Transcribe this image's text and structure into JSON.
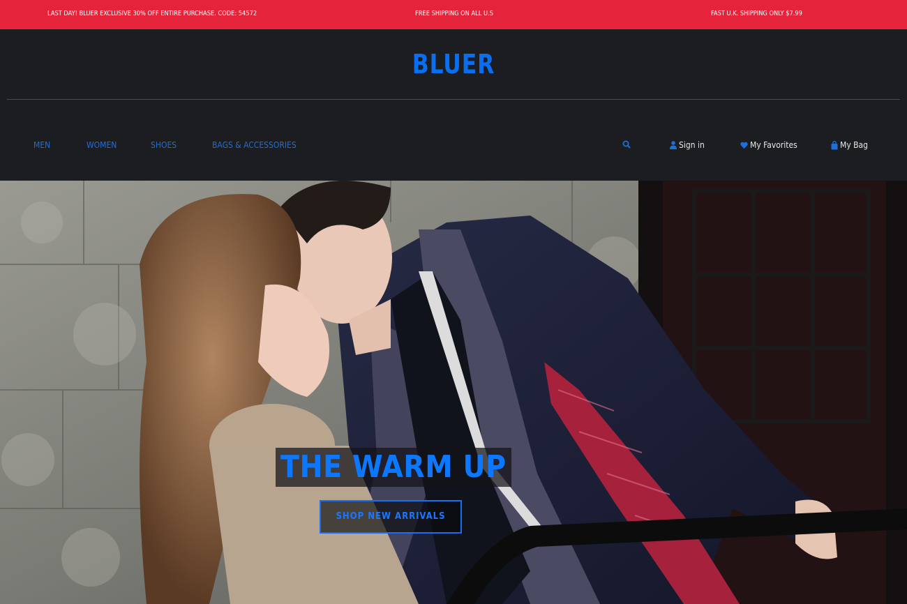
{
  "promo": {
    "left": "LAST DAY! BLUER EXCLUSIVE 30% OFF ENTIRE PURCHASE. CODE: 54572",
    "center": "FREE SHIPPING ON ALL U.S",
    "right": "FAST U.K. SHIPPING ONLY $7.99"
  },
  "brand": {
    "logo": "BLUER"
  },
  "nav": {
    "items": [
      {
        "label": "MEN"
      },
      {
        "label": "WOMEN"
      },
      {
        "label": "SHOES"
      },
      {
        "label": "BAGS & ACCESSORIES"
      }
    ]
  },
  "utility": {
    "signin": "Sign in",
    "favorites": "My Favorites",
    "bag": "My Bag"
  },
  "hero": {
    "title": "THE WARM UP",
    "cta": "SHOP NEW ARRIVALS"
  },
  "icons": {
    "search": "search-icon",
    "user": "user-icon",
    "heart": "heart-icon",
    "bag": "shopping-bag-icon"
  },
  "colors": {
    "promo_bg": "#e5243b",
    "header_bg": "#1c1d20",
    "accent": "#0a6ef0"
  }
}
